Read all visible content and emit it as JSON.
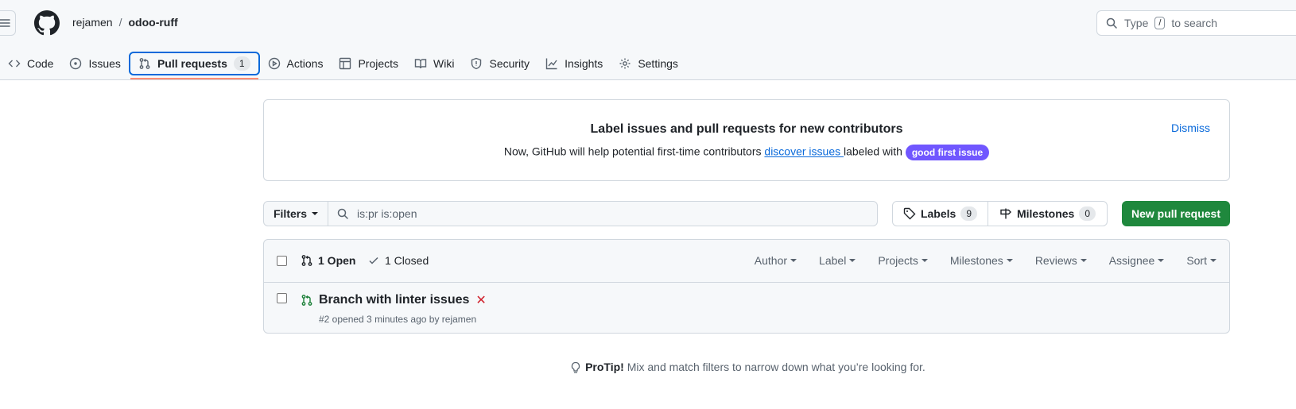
{
  "header": {
    "owner": "rejamen",
    "separator": "/",
    "repo": "odoo-ruff",
    "search_prefix": "Type",
    "search_key": "/",
    "search_suffix": "to search"
  },
  "tabs": [
    {
      "label": "Code",
      "icon": "code-icon"
    },
    {
      "label": "Issues",
      "icon": "issue-opened-icon"
    },
    {
      "label": "Pull requests",
      "icon": "git-pull-request-icon",
      "count": "1",
      "active": true
    },
    {
      "label": "Actions",
      "icon": "play-icon"
    },
    {
      "label": "Projects",
      "icon": "table-icon"
    },
    {
      "label": "Wiki",
      "icon": "book-icon"
    },
    {
      "label": "Security",
      "icon": "shield-icon"
    },
    {
      "label": "Insights",
      "icon": "graph-icon"
    },
    {
      "label": "Settings",
      "icon": "gear-icon"
    }
  ],
  "banner": {
    "title": "Label issues and pull requests for new contributors",
    "text_before": "Now, GitHub will help potential first-time contributors ",
    "link": "discover issues ",
    "text_after": "labeled with ",
    "label": "good first issue",
    "label_color": "#7057ff",
    "dismiss": "Dismiss"
  },
  "filters": {
    "filters_label": "Filters",
    "query": "is:pr is:open",
    "labels_label": "Labels",
    "labels_count": "9",
    "milestones_label": "Milestones",
    "milestones_count": "0",
    "new_pr_label": "New pull request",
    "new_pr_color": "#1f883d"
  },
  "list": {
    "open_label": "1 Open",
    "closed_label": "1 Closed",
    "menus": [
      "Author",
      "Label",
      "Projects",
      "Milestones",
      "Reviews",
      "Assignee",
      "Sort"
    ],
    "items": [
      {
        "title": "Branch with linter issues",
        "status_mark": "✕",
        "meta": "#2 opened 3 minutes ago by rejamen"
      }
    ]
  },
  "protip": {
    "bold": "ProTip!",
    "text": " Mix and match filters to narrow down what you’re looking for."
  }
}
